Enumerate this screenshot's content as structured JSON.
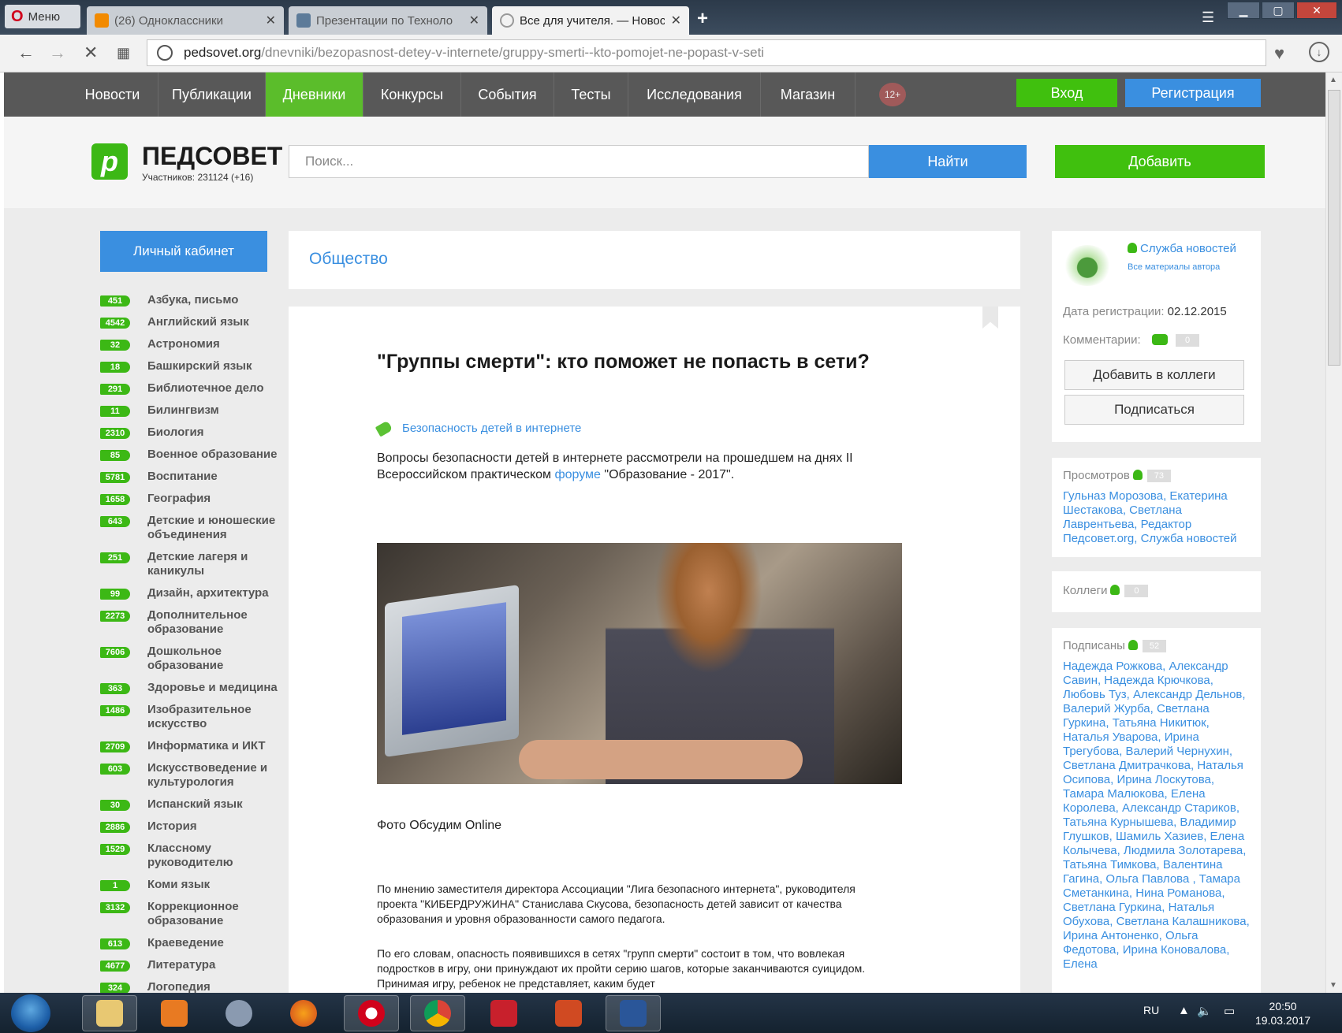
{
  "browser": {
    "menu_label": "Меню",
    "tabs": [
      {
        "title": "(26) Одноклассники",
        "close": "✕"
      },
      {
        "title": "Презентации по Техноло",
        "close": "✕"
      },
      {
        "title": "Все для учителя. — Новос",
        "close": "✕"
      }
    ],
    "new_tab": "+",
    "url_domain": "pedsovet.org",
    "url_path": "/dnevniki/bezopasnost-detey-v-internete/gruppy-smerti--kto-pomojet-ne-popast-v-seti"
  },
  "site_nav": {
    "items": [
      "Новости",
      "Публикации",
      "Дневники",
      "Конкурсы",
      "События",
      "Тесты",
      "Исследования",
      "Магазин"
    ],
    "active": "Дневники",
    "age": "12+",
    "login": "Вход",
    "register": "Регистрация"
  },
  "header": {
    "logo_letter": "p",
    "logo_text": "ПЕДСОВЕТ",
    "members": "Участников: 231124 (+16)",
    "search_placeholder": "Поиск...",
    "search_button": "Найти",
    "add_button": "Добавить"
  },
  "sidebar": {
    "cabinet": "Личный кабинет",
    "categories": [
      {
        "count": "451",
        "name": "Азбука, письмо"
      },
      {
        "count": "4542",
        "name": "Английский язык"
      },
      {
        "count": "32",
        "name": "Астрономия"
      },
      {
        "count": "18",
        "name": "Башкирский язык"
      },
      {
        "count": "291",
        "name": "Библиотечное дело"
      },
      {
        "count": "11",
        "name": "Билингвизм"
      },
      {
        "count": "2310",
        "name": "Биология"
      },
      {
        "count": "85",
        "name": "Военное образование"
      },
      {
        "count": "5781",
        "name": "Воспитание"
      },
      {
        "count": "1658",
        "name": "География"
      },
      {
        "count": "643",
        "name": "Детские и юношеские объединения"
      },
      {
        "count": "251",
        "name": "Детские лагеря и каникулы"
      },
      {
        "count": "99",
        "name": "Дизайн, архитектура"
      },
      {
        "count": "2273",
        "name": "Дополнительное образование"
      },
      {
        "count": "7606",
        "name": "Дошкольное образование"
      },
      {
        "count": "363",
        "name": "Здоровье и медицина"
      },
      {
        "count": "1486",
        "name": "Изобразительное искусство"
      },
      {
        "count": "2709",
        "name": "Информатика и ИКТ"
      },
      {
        "count": "603",
        "name": "Искусствоведение и культурология"
      },
      {
        "count": "30",
        "name": "Испанский язык"
      },
      {
        "count": "2886",
        "name": "История"
      },
      {
        "count": "1529",
        "name": "Классному руководителю"
      },
      {
        "count": "1",
        "name": "Коми язык"
      },
      {
        "count": "3132",
        "name": "Коррекционное образование"
      },
      {
        "count": "613",
        "name": "Краеведение"
      },
      {
        "count": "4677",
        "name": "Литература"
      },
      {
        "count": "324",
        "name": "Логопедия"
      }
    ]
  },
  "article": {
    "category": "Общество",
    "title": "\"Группы смерти\": кто поможет не попасть в сети?",
    "tag": "Безопасность детей в интернете",
    "lead_before": "Вопросы безопасности детей в интернете рассмотрели на прошедшем на днях II Всероссийском практическом ",
    "lead_link": "форуме",
    "lead_after": " \"Образование - 2017\".",
    "caption": "Фото Обсудим Online",
    "para1": "По мнению заместителя директора Ассоциации \"Лига безопасного интернета\", руководителя проекта \"КИБЕРДРУЖИНА\" Станислава Скусова, безопасность детей зависит от качества образования и уровня образованности самого педагога.",
    "para2": "По его словам, опасность появившихся в сетях \"групп смерти\" состоит в том, что вовлекая подростков в игру, они принуждают их пройти серию шагов, которые заканчиваются суицидом. Принимая игру, ребенок не представляет, каким будет"
  },
  "right": {
    "author_name": "Служба новостей",
    "author_all": "Все материалы автора",
    "reg_label": "Дата регистрации:",
    "reg_date": "02.12.2015",
    "comments_label": "Комментарии:",
    "comments_count": "0",
    "add_colleague": "Добавить в коллеги",
    "subscribe": "Подписаться",
    "views_label": "Просмотров",
    "views_count": "73",
    "viewers": "Гульназ Морозова, Екатерина Шестакова, Светлана Лаврентьева, Редактор Педсовет.org, Служба новостей",
    "colleagues_label": "Коллеги",
    "colleagues_count": "0",
    "subscribed_label": "Подписаны",
    "subscribed_count": "52",
    "subscribers": "Надежда Рожкова, Александр Савин, Надежда Крючкова, Любовь Туз, Александр Дельнов, Валерий Журба, Светлана Гуркина, Татьяна Никитюк, Наталья Уварова, Ирина Трегубова, Валерий Чернухин, Светлана Дмитрачкова, Наталья Осипова, Ирина Лоскутова, Тамара Малюкова, Елена Королева, Александр Стариков, Татьяна Курнышева, Владимир Глушков, Шамиль Хазиев, Елена Колычева, Людмила Золотарева, Татьяна Тимкова, Валентина Гагина, Ольга Павлова , Тамара Сметанкина, Нина Романова, Светлана Гуркина, Наталья Обухова, Светлана Калашникова, Ирина Антоненко, Ольга Федотова, Ирина Коновалова, Елена"
  },
  "taskbar": {
    "lang": "RU",
    "time": "20:50",
    "date": "19.03.2017"
  }
}
